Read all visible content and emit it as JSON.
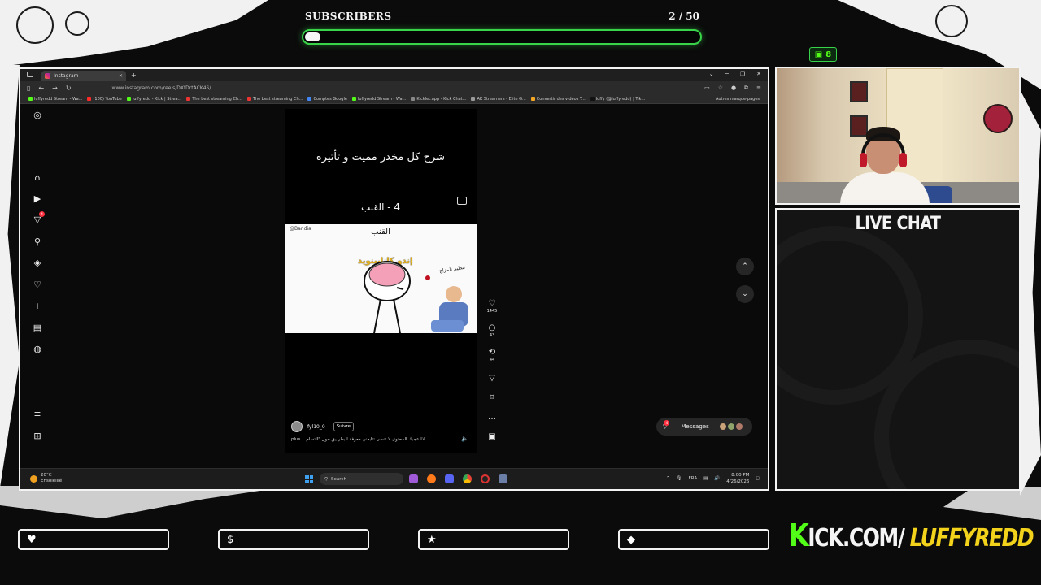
{
  "overlay": {
    "subscribers_label": "SUBSCRIBERS",
    "subscribers_count": "2 / 50",
    "subscribers_progress": 0.04,
    "kick_badge_count": "8",
    "live_chat_title": "LIVE CHAT",
    "kick_url_k": "K",
    "kick_url_part1": "ICK.COM/",
    "kick_url_part2": "LUFFYREDD",
    "goals": [
      {
        "icon": "heart-icon",
        "glyph": "♥"
      },
      {
        "icon": "dollar-icon",
        "glyph": "$"
      },
      {
        "icon": "star-icon",
        "glyph": "★"
      },
      {
        "icon": "diamond-icon",
        "glyph": "◆"
      }
    ],
    "colors": {
      "accent_green": "#39d34a",
      "kick_green": "#53fc18",
      "yellow": "#f2d21b"
    }
  },
  "browser": {
    "tab_title": "Instagram",
    "url": "www.instagram.com/reels/DXfDrtACK4S/",
    "bookmarks": [
      "luffyredd Stream - Wa...",
      "(100) YouTube",
      "luffyredd - Kick | Strea...",
      "The best streaming Ch...",
      "The best streaming Ch...",
      "Comptes Google",
      "luffyredd Stream - Wa...",
      "Kicklet.app - Kick Chat...",
      "AK Streamers - Elite G...",
      "Convertir des vidéos Y...",
      "luffy (@luffyredd) | Tik..."
    ],
    "bookmarks_other": "Autres marque-pages"
  },
  "instagram": {
    "reel_title": "شرح كل مخدر مميت و تأثيره",
    "reel_subtitle": "4 - القنب",
    "image_watermark": "@Bandia",
    "image_word": "القنب",
    "image_yellow": "إندو كانابينويد",
    "image_small": "تنظيم المزاج",
    "username": "fyl10_0",
    "follow_label": "Suivre",
    "caption": "اذا عجبك المحتوى لا تنسى تتابعني معرفة البطر يق حول \"التسام... plus",
    "likes": "1445",
    "comments": "43",
    "reposts": "44",
    "messages_label": "Messages",
    "messages_badge": "4",
    "notifications_badge": "4"
  },
  "taskbar": {
    "temperature": "20°C",
    "weather": "Ensoleillé",
    "search_placeholder": "Search",
    "language": "FRA",
    "time": "8:00 PM",
    "date": "4/26/2026"
  }
}
